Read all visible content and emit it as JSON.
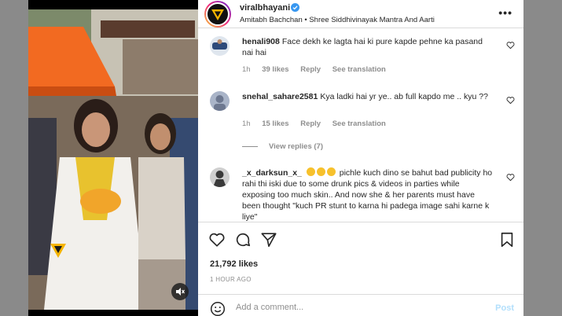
{
  "header": {
    "username": "viralbhayani",
    "subtitle": "Amitabh Bachchan • Shree Siddhivinayak Mantra And Aarti",
    "more_icon": "more-horizontal-icon"
  },
  "comments": [
    {
      "user": "henali908",
      "text": "Face dekh ke lagta hai ki pure kapde pehne ka pasand nai hai",
      "time": "1h",
      "likes": "39 likes",
      "reply": "Reply",
      "translate": "See translation"
    },
    {
      "user": "snehal_sahare2581",
      "text": "Kya ladki hai yr ye.. ab full kapdo me .. kyu ??",
      "time": "1h",
      "likes": "15 likes",
      "reply": "Reply",
      "translate": "See translation",
      "view_replies": "View replies (7)"
    },
    {
      "user": "_x_darksun_x_",
      "text": "pichle kuch dino se bahut bad publicity ho rahi thi iski due to some drunk pics & videos in parties while exposing too much skin.. And now she & her parents must have been thought \"kuch PR stunt to karna hi padega image sahi karne k liye\"",
      "emojis": "😂😂😂"
    }
  ],
  "actions": {
    "like_icon": "heart-icon",
    "comment_icon": "comment-icon",
    "share_icon": "send-icon",
    "save_icon": "bookmark-icon"
  },
  "likes": "21,792 likes",
  "time": "1 HOUR AGO",
  "composer": {
    "placeholder": "Add a comment...",
    "post_label": "Post"
  },
  "colors": {
    "accent_link": "#b2dffc",
    "verified_blue": "#3897f0",
    "text": "#262626",
    "muted": "#8e8e8e"
  }
}
